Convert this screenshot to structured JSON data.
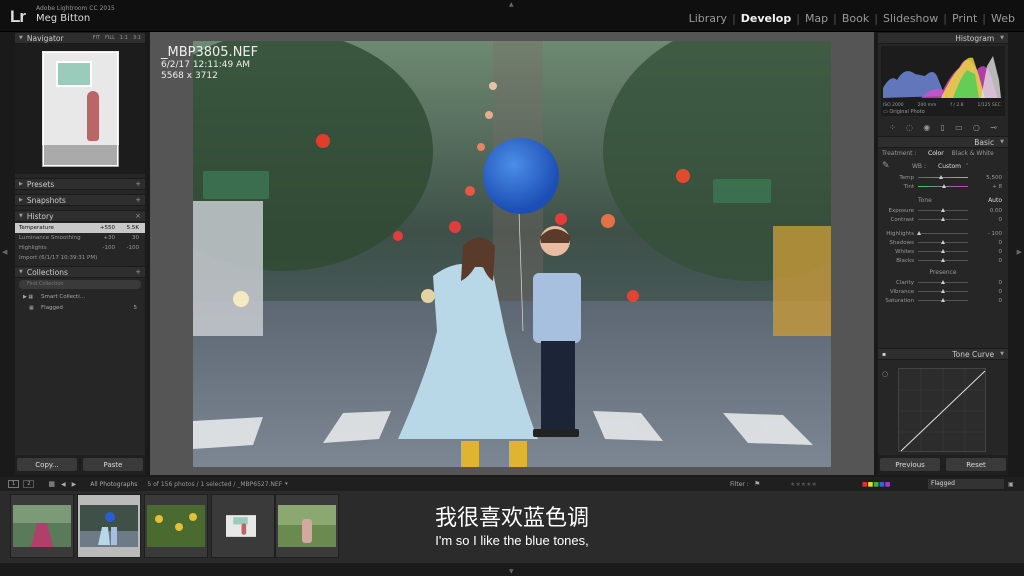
{
  "app": {
    "logo": "Lr",
    "product": "Adobe Lightroom CC 2015",
    "user": "Meg Bitton"
  },
  "modules": [
    "Library",
    "Develop",
    "Map",
    "Book",
    "Slideshow",
    "Print",
    "Web"
  ],
  "left": {
    "navigator": {
      "title": "Navigator",
      "options": [
        "FIT",
        "FILL",
        "1:1",
        "3:1"
      ]
    },
    "presets": "Presets",
    "snapshots": "Snapshots",
    "history": {
      "title": "History",
      "items": [
        {
          "label": "Temperature",
          "v1": "+550",
          "v2": "5.5K"
        },
        {
          "label": "Luminance Smoothing",
          "v1": "+30",
          "v2": "30"
        },
        {
          "label": "Highlights",
          "v1": "-100",
          "v2": "-100"
        },
        {
          "label": "Import (6/1/17 10:39:31 PM)",
          "v1": "",
          "v2": ""
        }
      ]
    },
    "collections": {
      "title": "Collections",
      "find": "Find Collection",
      "items": [
        {
          "label": "Smart Collecti...",
          "count": ""
        },
        {
          "label": "Flagged",
          "count": "5"
        }
      ]
    },
    "copy": "Copy...",
    "paste": "Paste"
  },
  "info": {
    "filename": "_MBP3805.NEF",
    "date": "6/2/17 12:11:49 AM",
    "dims": "5568 x 3712"
  },
  "right": {
    "histogram": {
      "title": "Histogram",
      "iso": "ISO 2000",
      "lens": "200 mm",
      "aperture": "f / 2.8",
      "shutter": "1/125 SEC",
      "original": "Original Photo"
    },
    "basic": {
      "title": "Basic",
      "treatment_label": "Treatment :",
      "color": "Color",
      "bw": "Black & White",
      "wb_label": "WB :",
      "wb_value": "Custom",
      "temp": {
        "label": "Temp",
        "value": "5,500",
        "pos": 0.45
      },
      "tint": {
        "label": "Tint",
        "value": "+ 8",
        "pos": 0.52
      },
      "tone": "Tone",
      "auto": "Auto",
      "tone_sliders": [
        {
          "label": "Exposure",
          "value": "0.00",
          "pos": 0.5
        },
        {
          "label": "Contrast",
          "value": "0",
          "pos": 0.5
        }
      ],
      "tone_sliders2": [
        {
          "label": "Highlights",
          "value": "- 100",
          "pos": 0.02
        },
        {
          "label": "Shadows",
          "value": "0",
          "pos": 0.5
        },
        {
          "label": "Whites",
          "value": "0",
          "pos": 0.5
        },
        {
          "label": "Blacks",
          "value": "0",
          "pos": 0.5
        }
      ],
      "presence": "Presence",
      "presence_sliders": [
        {
          "label": "Clarity",
          "value": "0",
          "pos": 0.5
        },
        {
          "label": "Vibrance",
          "value": "0",
          "pos": 0.5
        },
        {
          "label": "Saturation",
          "value": "0",
          "pos": 0.5
        }
      ]
    },
    "tonecurve": "Tone Curve",
    "previous": "Previous",
    "reset": "Reset"
  },
  "filmbar": {
    "source": "All Photographs",
    "status": "5 of 156 photos / 1 selected / _MBP6527.NEF",
    "filter_label": "Filter :",
    "filter_value": "Flagged"
  },
  "subtitles": {
    "cn": "我很喜欢蓝色调",
    "en": "I'm so I like the blue tones,"
  }
}
